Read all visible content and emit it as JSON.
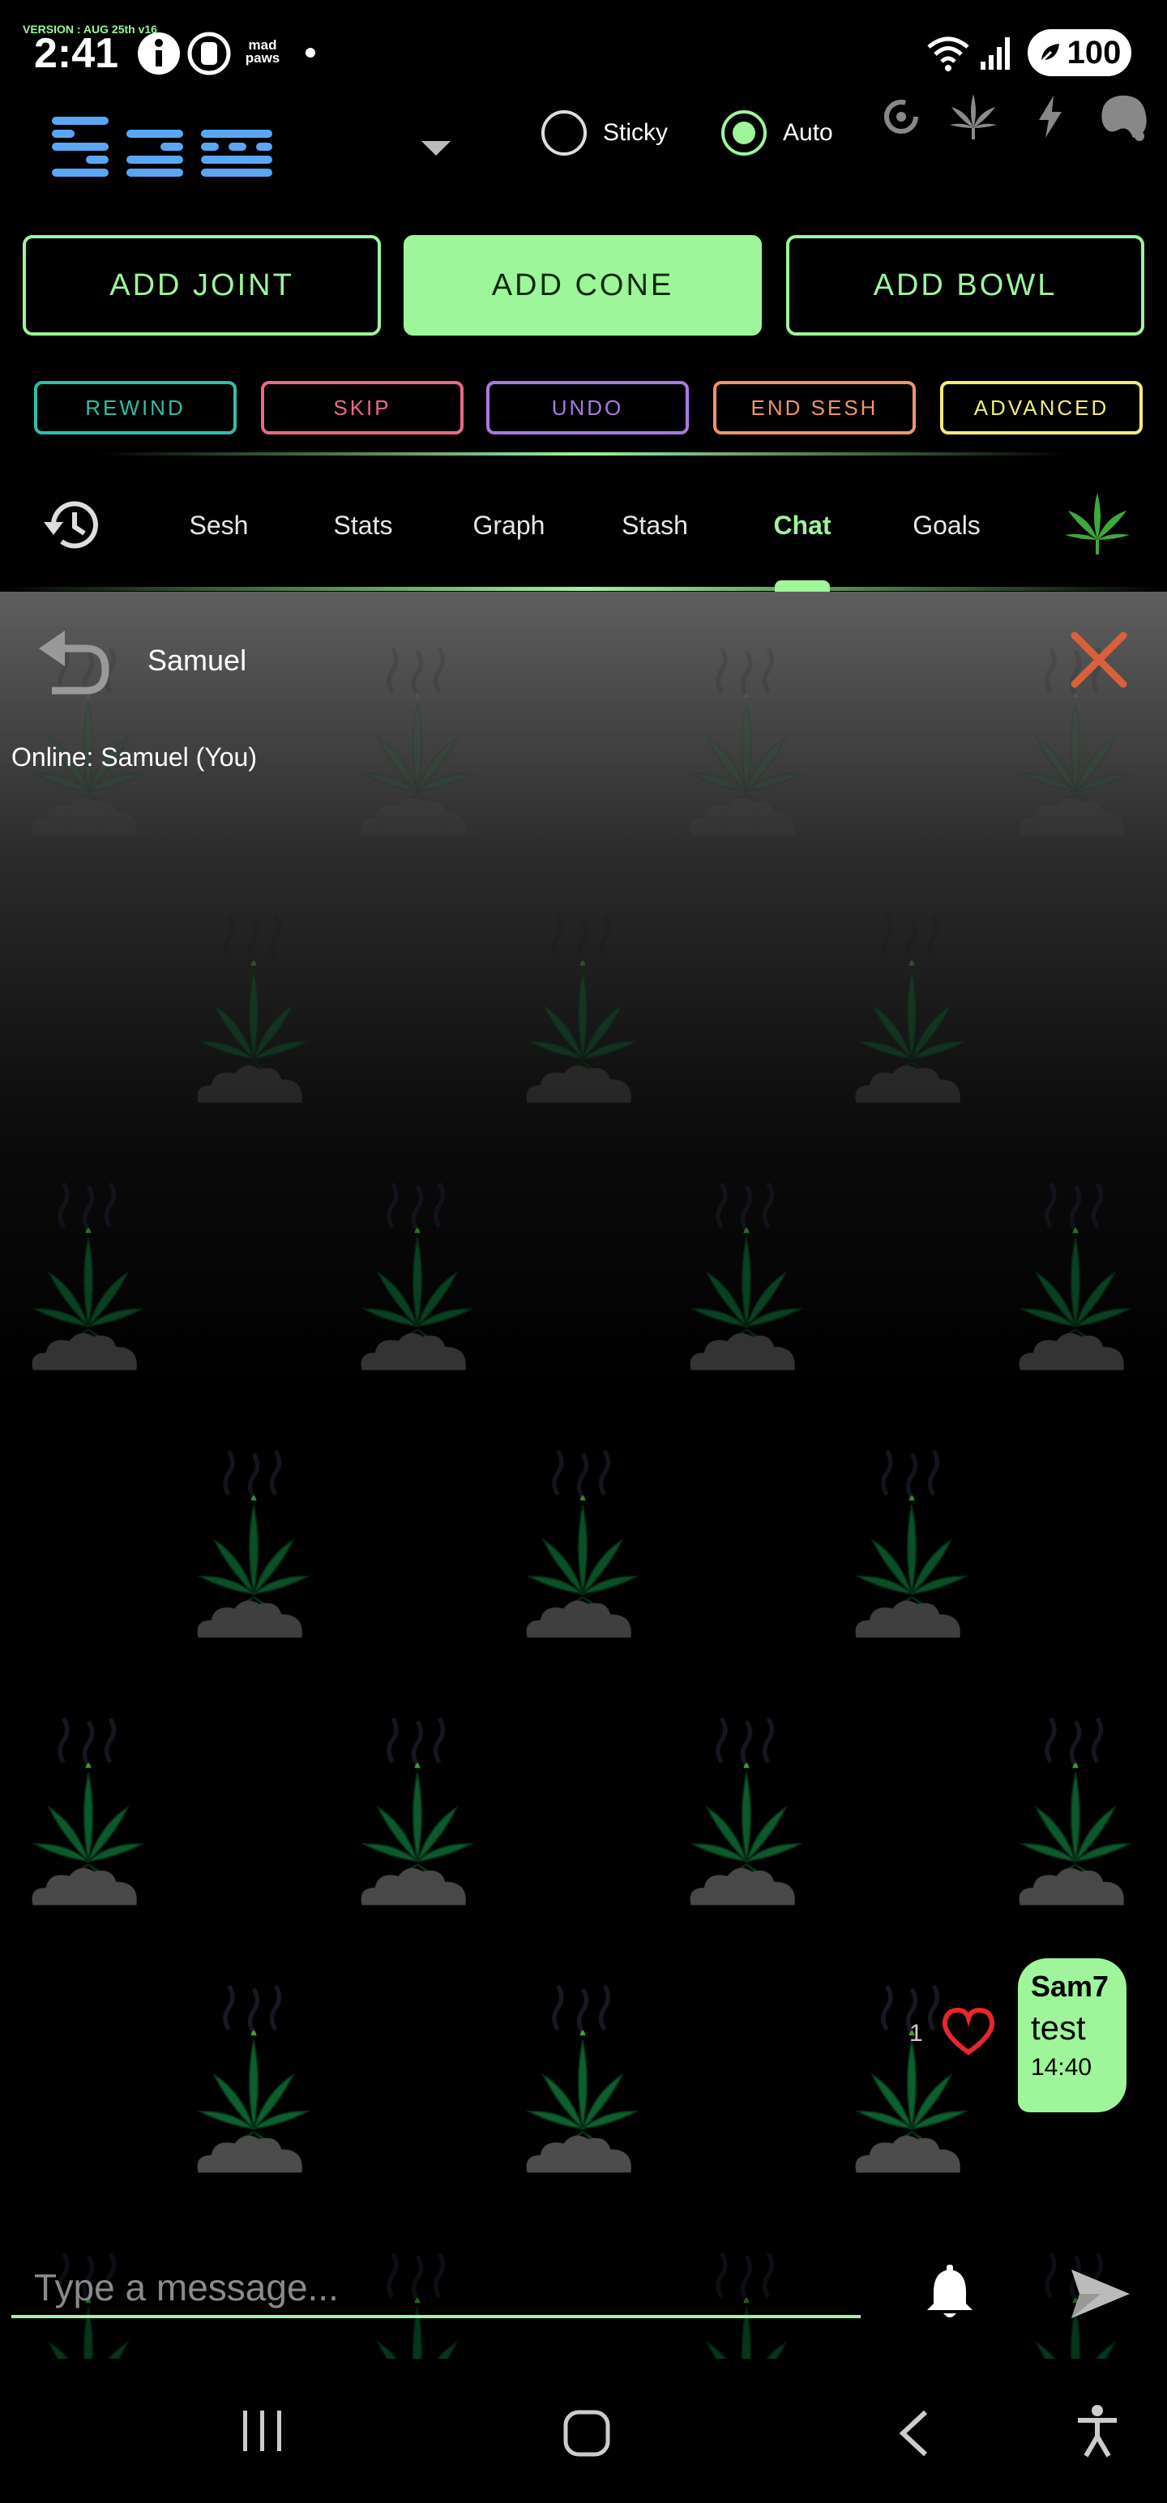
{
  "status_bar": {
    "version": "VERSION : AUG 25th v16",
    "time": "2:41",
    "madpaws": "mad paws",
    "battery": "100"
  },
  "header": {
    "logo_text": "Sam",
    "sticky_label": "Sticky",
    "auto_label": "Auto",
    "sticky_checked": false,
    "auto_checked": true
  },
  "add_buttons": [
    "ADD JOINT",
    "ADD CONE",
    "ADD BOWL"
  ],
  "add_buttons_active": "ADD CONE",
  "action_buttons": [
    {
      "label": "REWIND",
      "color": "#2fbfa8"
    },
    {
      "label": "SKIP",
      "color": "#e86a86"
    },
    {
      "label": "UNDO",
      "color": "#a979e6"
    },
    {
      "label": "END SESH",
      "color": "#f0946a"
    },
    {
      "label": "ADVANCED",
      "color": "#f2ec7a"
    }
  ],
  "tabs": [
    "Sesh",
    "Stats",
    "Graph",
    "Stash",
    "Chat",
    "Goals"
  ],
  "active_tab": "Chat",
  "chat": {
    "title": "Samuel",
    "online": "Online: Samuel (You)",
    "messages": [
      {
        "sender": "Sam7",
        "text": "test",
        "time": "14:40",
        "likes": "1"
      }
    ],
    "input_placeholder": "Type a message..."
  },
  "colors": {
    "accent": "#9ef59a",
    "close": "#d9603b",
    "heart": "#e8262b",
    "logo": "#5aa6f5"
  },
  "icons": [
    "info-icon",
    "watch-icon",
    "wifi-icon",
    "signal-icon",
    "battery-icon",
    "history-icon",
    "leaf-icon",
    "bolt-icon",
    "bell-icon",
    "back-icon",
    "close-icon",
    "heart-icon",
    "send-icon"
  ]
}
